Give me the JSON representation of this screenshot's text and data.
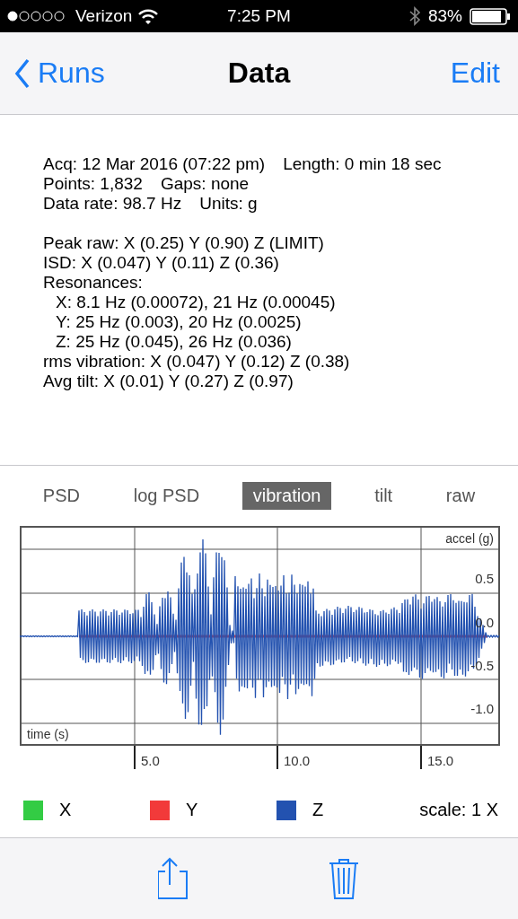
{
  "status_bar": {
    "carrier": "Verizon",
    "time": "7:25 PM",
    "battery": "83%"
  },
  "nav": {
    "back": "Runs",
    "title": "Data",
    "action": "Edit"
  },
  "summary": [
    [
      {
        "parts": [
          "Acq: 12 Mar 2016 (07:22 pm)",
          "Length: 0 min 18 sec"
        ]
      },
      {
        "parts": [
          "Points: 1,832",
          "Gaps: none"
        ]
      },
      {
        "parts": [
          "Data rate: 98.7 Hz",
          "Units: g"
        ]
      }
    ],
    [
      {
        "parts": [
          "Peak raw: X (0.25) Y (0.90) Z (LIMIT)"
        ]
      },
      {
        "parts": [
          "ISD: X (0.047) Y (0.11) Z (0.36)"
        ]
      },
      {
        "parts": [
          "Resonances:"
        ],
        "children": [
          {
            "parts": [
              "X:  8.1 Hz (0.00072), 21 Hz (0.00045)"
            ]
          },
          {
            "parts": [
              "Y:  25 Hz (0.003), 20 Hz (0.0025)"
            ]
          },
          {
            "parts": [
              "Z:  25 Hz (0.045), 26 Hz (0.036)"
            ]
          }
        ]
      },
      {
        "parts": [
          "rms vibration: X (0.047) Y (0.12) Z (0.38)"
        ]
      },
      {
        "parts": [
          "Avg tilt: X (0.01) Y (0.27) Z (0.97)"
        ]
      }
    ]
  ],
  "tabs": [
    {
      "label": "PSD",
      "selected": false
    },
    {
      "label": "log PSD",
      "selected": false
    },
    {
      "label": "vibration",
      "selected": true
    },
    {
      "label": "tilt",
      "selected": false
    },
    {
      "label": "raw",
      "selected": false
    }
  ],
  "chart": {
    "ylabel": "accel (g)",
    "xlabel": "time (s)",
    "yticks": [
      "0.5",
      "0.0",
      "-0.5",
      "-1.0"
    ],
    "xticks": [
      "5.0",
      "10.0",
      "15.0"
    ]
  },
  "legend": [
    {
      "label": "X",
      "color": "#33cc44"
    },
    {
      "label": "Y",
      "color": "#f23a3a"
    },
    {
      "label": "Z",
      "color": "#2352b0"
    }
  ],
  "scale": "scale: 1 X"
}
